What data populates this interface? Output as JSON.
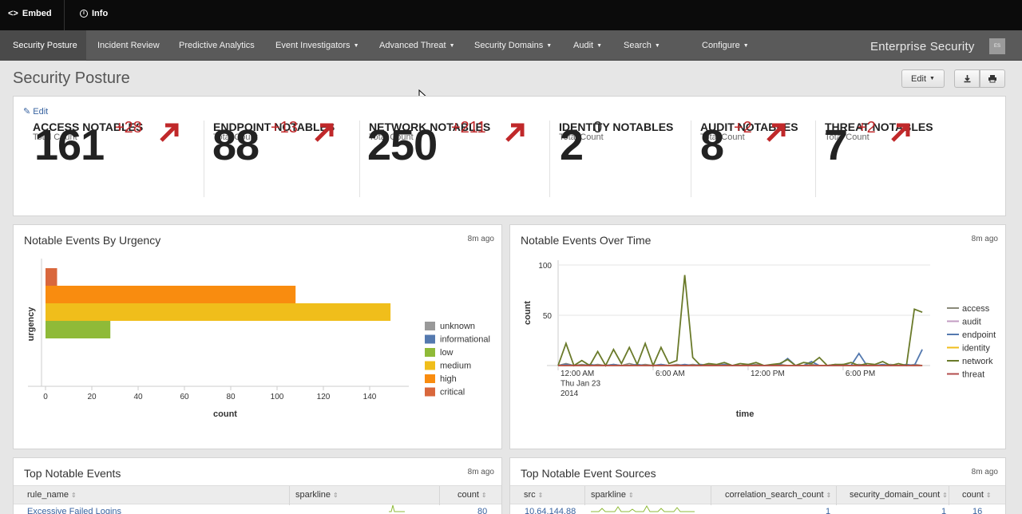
{
  "topbar": {
    "embed_label": "Embed",
    "info_label": "Info"
  },
  "nav": {
    "items": [
      {
        "label": "Security Posture",
        "caret": false
      },
      {
        "label": "Incident Review",
        "caret": false
      },
      {
        "label": "Predictive Analytics",
        "caret": false
      },
      {
        "label": "Event Investigators",
        "caret": true
      },
      {
        "label": "Advanced Threat",
        "caret": true
      },
      {
        "label": "Security Domains",
        "caret": true
      },
      {
        "label": "Audit",
        "caret": true
      },
      {
        "label": "Search",
        "caret": true
      },
      {
        "label": "Configure",
        "caret": true
      }
    ],
    "brand": "Enterprise Security",
    "brand_badge": "ES"
  },
  "page": {
    "title": "Security Posture",
    "edit_button": "Edit"
  },
  "notables": {
    "edit_link": "Edit",
    "kpis": [
      {
        "title": "ACCESS NOTABLES",
        "sub": "Total Count",
        "value": "161",
        "delta": "+28"
      },
      {
        "title": "ENDPOINT NOTABLES",
        "sub": "Total Count",
        "value": "88",
        "delta": "+13"
      },
      {
        "title": "NETWORK NOTABLES",
        "sub": "Total Count",
        "value": "250",
        "delta": "+211"
      },
      {
        "title": "IDENTITY NOTABLES",
        "sub": "Total Count",
        "value": "2",
        "delta": "0"
      },
      {
        "title": "AUDIT NOTABLES",
        "sub": "Total Count",
        "value": "8",
        "delta": "+2"
      },
      {
        "title": "THREAT NOTABLES",
        "sub": "Total Count",
        "value": "7",
        "delta": "+2"
      }
    ]
  },
  "urgency_panel": {
    "title": "Notable Events By Urgency",
    "ago": "8m ago"
  },
  "time_panel": {
    "title": "Notable Events Over Time",
    "ago": "8m ago"
  },
  "chart_data": [
    {
      "type": "bar",
      "orientation": "horizontal",
      "title": "Notable Events By Urgency",
      "xlabel": "count",
      "ylabel": "urgency",
      "categories": [
        "critical",
        "high",
        "medium",
        "low"
      ],
      "values": [
        5,
        108,
        149,
        28
      ],
      "colors": [
        "#d9673c",
        "#f98c0f",
        "#f0be1b",
        "#8fba38"
      ],
      "xlim": [
        0,
        150
      ],
      "xticks": [
        0,
        20,
        40,
        60,
        80,
        100,
        120,
        140
      ],
      "legend": [
        {
          "label": "unknown",
          "color": "#999999"
        },
        {
          "label": "informational",
          "color": "#5479af"
        },
        {
          "label": "low",
          "color": "#8fba38"
        },
        {
          "label": "medium",
          "color": "#f0be1b"
        },
        {
          "label": "high",
          "color": "#f98c0f"
        },
        {
          "label": "critical",
          "color": "#d9673c"
        }
      ],
      "legend_position": "right"
    },
    {
      "type": "line",
      "title": "Notable Events Over Time",
      "xlabel": "time",
      "ylabel": "count",
      "ylim": [
        0,
        100
      ],
      "yticks": [
        50,
        100
      ],
      "xtick_labels": [
        {
          "lines": [
            "12:00 AM",
            "Thu Jan 23",
            "2014"
          ],
          "hour": 0
        },
        {
          "lines": [
            "6:00 AM"
          ],
          "hour": 6
        },
        {
          "lines": [
            "12:00 PM"
          ],
          "hour": 12
        },
        {
          "lines": [
            "6:00 PM"
          ],
          "hour": 18
        }
      ],
      "x_hours": [
        0,
        0.5,
        1,
        1.5,
        2,
        2.5,
        3,
        3.5,
        4,
        4.5,
        5,
        5.5,
        6,
        6.5,
        7,
        7.5,
        8,
        8.5,
        9,
        9.5,
        10,
        10.5,
        11,
        11.5,
        12,
        12.5,
        13,
        13.5,
        14,
        14.5,
        15,
        15.5,
        16,
        16.5,
        17,
        17.5,
        18,
        18.5,
        19,
        19.5,
        20,
        20.5,
        21,
        21.5,
        22,
        22.5,
        23
      ],
      "series": [
        {
          "name": "access",
          "color": "#8a8a7a",
          "values": [
            0,
            2,
            0,
            1,
            0,
            1,
            0,
            1,
            0,
            2,
            0,
            1,
            0,
            1,
            0,
            1,
            0,
            1,
            0,
            1,
            0,
            1,
            0,
            0,
            0,
            1,
            0,
            0,
            1,
            0,
            0,
            0,
            1,
            0,
            0,
            1,
            0,
            0,
            1,
            0,
            0,
            0,
            1,
            0,
            0,
            1,
            0
          ]
        },
        {
          "name": "audit",
          "color": "#c39cc3",
          "values": [
            0,
            0,
            0,
            0,
            0,
            0,
            0,
            0,
            0,
            0,
            0,
            0,
            0,
            0,
            0,
            0,
            0,
            0,
            0,
            0,
            0,
            0,
            0,
            0,
            0,
            0,
            0,
            0,
            0,
            0,
            0,
            0,
            0,
            0,
            0,
            0,
            0,
            0,
            0,
            0,
            0,
            0,
            0,
            0,
            0,
            0,
            0
          ]
        },
        {
          "name": "endpoint",
          "color": "#5479af",
          "values": [
            0,
            1,
            0,
            0,
            1,
            0,
            0,
            1,
            0,
            0,
            1,
            0,
            0,
            1,
            0,
            0,
            1,
            0,
            1,
            0,
            0,
            1,
            0,
            0,
            1,
            0,
            0,
            0,
            1,
            7,
            0,
            0,
            4,
            0,
            0,
            0,
            1,
            0,
            12,
            0,
            0,
            1,
            0,
            0,
            1,
            0,
            16
          ]
        },
        {
          "name": "identity",
          "color": "#f0be1b",
          "values": [
            0,
            0,
            0,
            0,
            0,
            0,
            0,
            0,
            0,
            0,
            0,
            0,
            0,
            0,
            0,
            0,
            0,
            0,
            0,
            0,
            0,
            0,
            0,
            0,
            0,
            0,
            0,
            0,
            0,
            0,
            0,
            0,
            0,
            0,
            0,
            0,
            0,
            0,
            0,
            0,
            0,
            0,
            0,
            0,
            0,
            0,
            0
          ]
        },
        {
          "name": "network",
          "color": "#6a7a2a",
          "values": [
            0,
            22,
            0,
            5,
            0,
            14,
            0,
            16,
            2,
            18,
            1,
            22,
            0,
            18,
            2,
            5,
            90,
            8,
            0,
            2,
            1,
            3,
            0,
            2,
            1,
            3,
            0,
            1,
            2,
            6,
            0,
            3,
            2,
            8,
            0,
            1,
            1,
            3,
            0,
            2,
            1,
            4,
            0,
            2,
            0,
            56,
            53
          ]
        },
        {
          "name": "threat",
          "color": "#b34c4c",
          "values": [
            0,
            0,
            0,
            0,
            0,
            0,
            0,
            0,
            0,
            0,
            0,
            0,
            0,
            0,
            0,
            0,
            0,
            0,
            0,
            0,
            0,
            0,
            0,
            0,
            0,
            0,
            0,
            0,
            0,
            0,
            0,
            0,
            0,
            0,
            0,
            0,
            0,
            0,
            0,
            0,
            0,
            0,
            0,
            0,
            0,
            0,
            0
          ]
        }
      ],
      "legend_position": "right"
    }
  ],
  "top_notables": {
    "title": "Top Notable Events",
    "ago": "8m ago",
    "columns": [
      "rule_name",
      "sparkline",
      "count"
    ],
    "rows": [
      [
        "Excessive Failed Logins",
        "",
        "80"
      ]
    ]
  },
  "top_sources": {
    "title": "Top Notable Event Sources",
    "ago": "8m ago",
    "columns": [
      "src",
      "sparkline",
      "correlation_search_count",
      "security_domain_count",
      "count"
    ],
    "rows": [
      [
        "10.64.144.88",
        "",
        "1",
        "1",
        "16"
      ]
    ]
  }
}
